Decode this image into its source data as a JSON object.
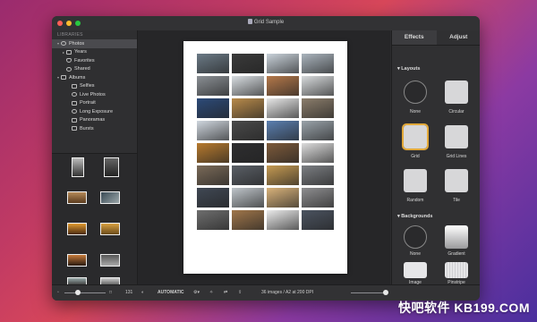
{
  "window": {
    "title": "Grid Sample"
  },
  "sidebar": {
    "section_label": "LIBRARIES",
    "items": [
      {
        "label": "Photos",
        "icon": "photos-icon"
      },
      {
        "label": "Years",
        "icon": "folder-icon"
      },
      {
        "label": "Favorites",
        "icon": "heart-icon"
      },
      {
        "label": "Shared",
        "icon": "cloud-icon"
      },
      {
        "label": "Albums",
        "icon": "folder-icon"
      },
      {
        "label": "Selfies",
        "icon": "person-icon"
      },
      {
        "label": "Live Photos",
        "icon": "live-photo-icon"
      },
      {
        "label": "Portrait",
        "icon": "cube-icon"
      },
      {
        "label": "Long Exposure",
        "icon": "aperture-icon"
      },
      {
        "label": "Panoramas",
        "icon": "panorama-icon"
      },
      {
        "label": "Bursts",
        "icon": "stack-icon"
      }
    ]
  },
  "bottombar": {
    "count_label": "131",
    "mode_label": "AUTOMATIC",
    "status": "36 images / A2 at 200 DPI"
  },
  "inspector": {
    "tabs": [
      {
        "label": "Effects",
        "active": true
      },
      {
        "label": "Adjust",
        "active": false
      }
    ],
    "layouts_label": "Layouts",
    "layouts": [
      {
        "label": "None"
      },
      {
        "label": "Circular"
      },
      {
        "label": "Grid",
        "selected": true
      },
      {
        "label": "Grid Lines"
      },
      {
        "label": "Random"
      },
      {
        "label": "Tile"
      }
    ],
    "backgrounds_label": "Backgrounds",
    "backgrounds": [
      {
        "label": "None"
      },
      {
        "label": "Gradient"
      },
      {
        "label": "Image"
      },
      {
        "label": "Pinstripe"
      }
    ]
  },
  "watermark": "快吧软件 KB199.COM",
  "colors": {
    "accent_selection": "#e2a93a",
    "sidebar_selected": "#4a4a4e"
  }
}
